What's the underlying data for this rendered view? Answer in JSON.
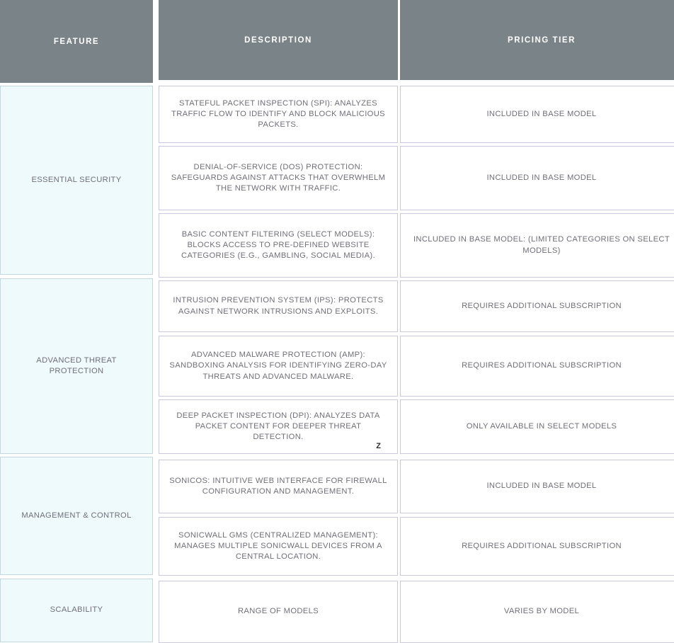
{
  "table": {
    "columns": [
      {
        "key": "feature",
        "label": "FEATURE"
      },
      {
        "key": "description",
        "label": "DESCRIPTION"
      },
      {
        "key": "pricing_tier",
        "label": "PRICING TIER"
      }
    ],
    "header_background": "#7a8488",
    "header_text_color": "#ffffff",
    "feature_cell_background": "#effafd",
    "body_text_color": "#6f6f78",
    "groups": [
      {
        "feature": "ESSENTIAL SECURITY",
        "rows": [
          {
            "description": "STATEFUL PACKET INSPECTION (SPI): ANALYZES TRAFFIC FLOW TO IDENTIFY AND BLOCK MALICIOUS PACKETS.",
            "pricing_tier": "INCLUDED IN BASE MODEL"
          },
          {
            "description": "DENIAL-OF-SERVICE (DOS) PROTECTION: SAFEGUARDS AGAINST ATTACKS THAT OVERWHELM THE NETWORK WITH TRAFFIC.",
            "pricing_tier": "INCLUDED IN BASE MODEL"
          },
          {
            "description": "BASIC CONTENT FILTERING (SELECT MODELS): BLOCKS ACCESS TO PRE-DEFINED WEBSITE CATEGORIES (E.G., GAMBLING, SOCIAL MEDIA).",
            "pricing_tier": "INCLUDED IN BASE MODEL: (LIMITED CATEGORIES ON SELECT MODELS)"
          }
        ]
      },
      {
        "feature": "ADVANCED THREAT PROTECTION",
        "rows": [
          {
            "description": "INTRUSION PREVENTION SYSTEM (IPS): PROTECTS AGAINST NETWORK INTRUSIONS AND EXPLOITS.",
            "pricing_tier": "REQUIRES ADDITIONAL SUBSCRIPTION"
          },
          {
            "description": "ADVANCED MALWARE PROTECTION (AMP): SANDBOXING ANALYSIS FOR IDENTIFYING ZERO-DAY THREATS AND ADVANCED MALWARE.",
            "pricing_tier": "REQUIRES ADDITIONAL SUBSCRIPTION"
          },
          {
            "description": "DEEP PACKET INSPECTION (DPI): ANALYZES DATA PACKET CONTENT FOR DEEPER THREAT DETECTION.",
            "description_stray_glyph": "Z",
            "pricing_tier": "ONLY AVAILABLE IN SELECT MODELS"
          }
        ]
      },
      {
        "feature": "MANAGEMENT & CONTROL",
        "rows": [
          {
            "description": "SONICOS: INTUITIVE WEB INTERFACE FOR FIREWALL CONFIGURATION AND MANAGEMENT.",
            "pricing_tier": "INCLUDED IN BASE MODEL"
          },
          {
            "description": "SONICWALL GMS (CENTRALIZED MANAGEMENT): MANAGES MULTIPLE SONICWALL DEVICES FROM A CENTRAL LOCATION.",
            "pricing_tier": "REQUIRES ADDITIONAL SUBSCRIPTION"
          }
        ]
      },
      {
        "feature": "SCALABILITY",
        "rows": [
          {
            "description": "RANGE OF MODELS",
            "pricing_tier": "VARIES BY MODEL"
          }
        ]
      }
    ]
  }
}
